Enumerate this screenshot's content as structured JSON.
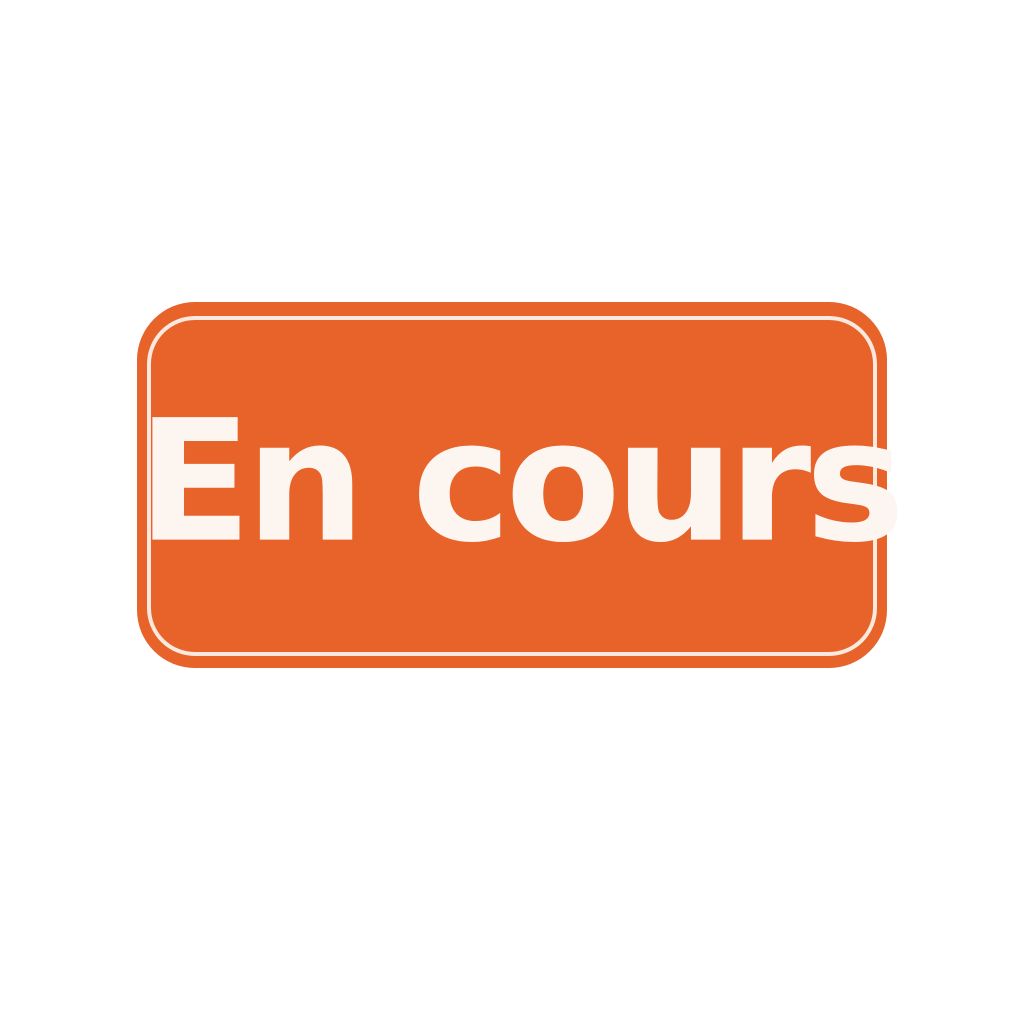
{
  "badge": {
    "label": "En cours",
    "fill_color": "#e8632a",
    "border_color": "#fbe9df",
    "text_color": "#fdf5ef"
  }
}
